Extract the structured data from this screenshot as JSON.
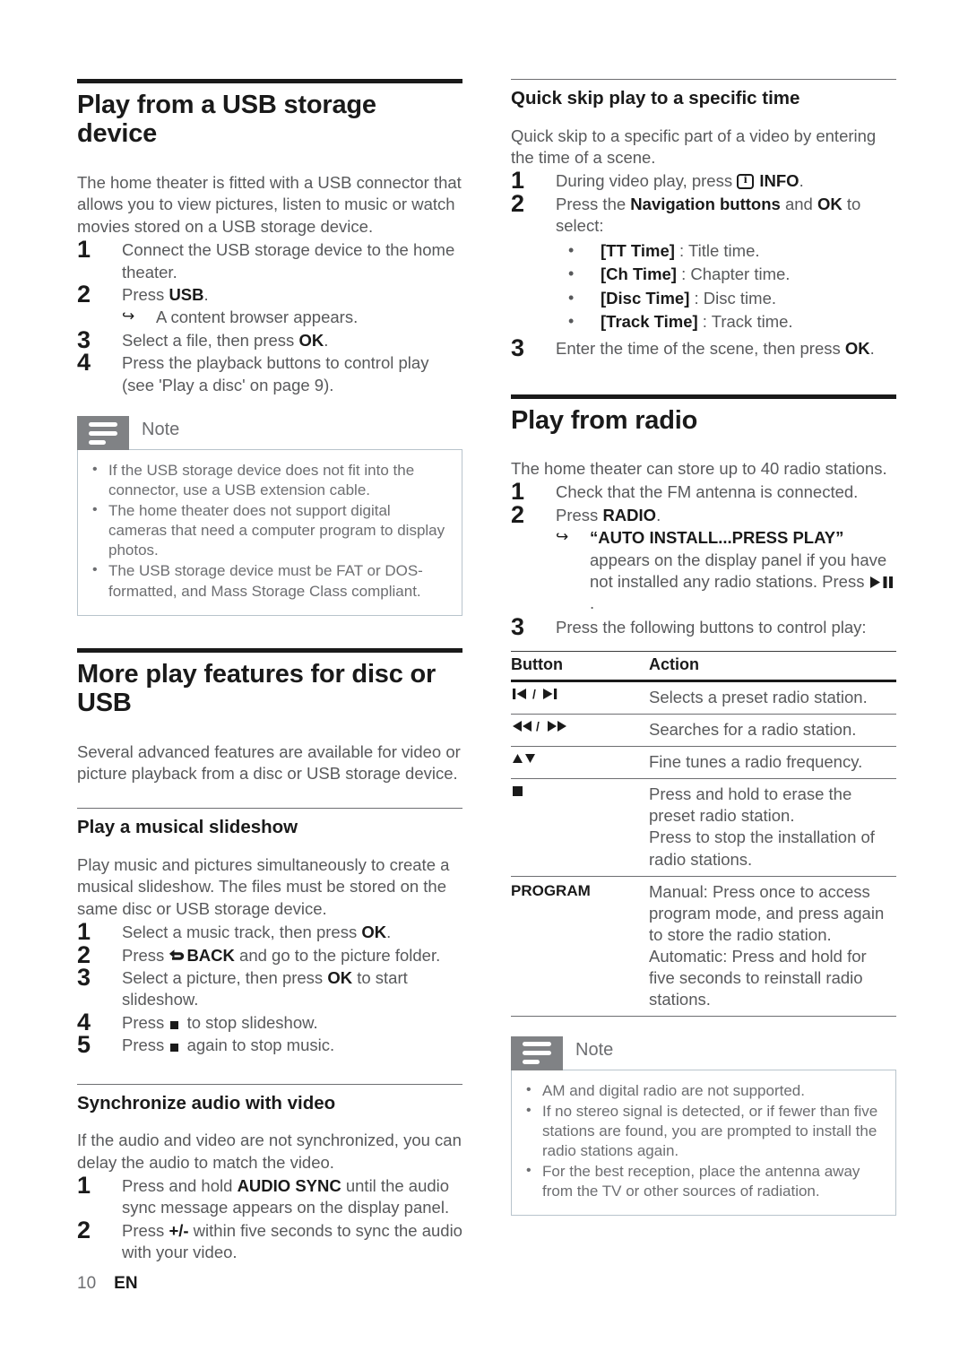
{
  "page": {
    "number": "10",
    "language": "EN"
  },
  "left_column": {
    "section_usb": {
      "heading": "Play from a USB storage device",
      "intro": "The home theater is fitted with a USB connector that allows you to view pictures, listen to music or watch movies stored on a USB storage device.",
      "steps": [
        {
          "num": "1",
          "text": "Connect the USB storage device to the home theater."
        },
        {
          "num": "2",
          "pre": "Press ",
          "bold": "USB",
          "post": ".",
          "result": "A content browser appears."
        },
        {
          "num": "3",
          "pre": "Select a file, then press ",
          "bold": "OK",
          "post": "."
        },
        {
          "num": "4",
          "text": "Press the playback buttons to control play (see 'Play a disc' on page 9)."
        }
      ],
      "note": {
        "title": "Note",
        "items": [
          "If the USB storage device does not fit into the connector, use a USB extension cable.",
          "The home theater does not support digital cameras that need a computer program to display photos.",
          "The USB storage device must be FAT or DOS-formatted, and Mass Storage Class compliant."
        ]
      }
    },
    "section_more": {
      "heading": "More play features for disc or USB",
      "intro": "Several advanced features are available for video or picture playback from a disc or USB storage device.",
      "slideshow": {
        "heading": "Play a musical slideshow",
        "intro": "Play music and pictures simultaneously to create a musical slideshow. The files must be stored on the same disc or USB storage device.",
        "steps": [
          {
            "num": "1",
            "pre": "Select a music track, then press ",
            "bold": "OK",
            "post": "."
          },
          {
            "num": "2",
            "pre": "Press ",
            "icon": "back-arrow-icon",
            "bold": "BACK",
            "post": " and go to the picture folder."
          },
          {
            "num": "3",
            "pre": "Select a picture, then press ",
            "bold": "OK",
            "post": " to start slideshow."
          },
          {
            "num": "4",
            "pre": "Press ",
            "icon": "stop-icon",
            "post": " to stop slideshow."
          },
          {
            "num": "5",
            "pre": "Press ",
            "icon": "stop-icon",
            "post": " again to stop music."
          }
        ]
      },
      "sync": {
        "heading": "Synchronize audio with video",
        "intro": "If the audio and video are not synchronized, you can delay the audio to match the video.",
        "steps": [
          {
            "num": "1",
            "pre": "Press and hold ",
            "bold": "AUDIO SYNC",
            "post": " until the audio sync message appears on the display panel."
          },
          {
            "num": "2",
            "pre": "Press ",
            "bold": "+/-",
            "post": " within five seconds to sync the audio with your video."
          }
        ]
      }
    }
  },
  "right_column": {
    "section_quickskip": {
      "heading": "Quick skip play to a specific time",
      "intro": "Quick skip to a specific part of a video by entering the time of a scene.",
      "step1": {
        "num": "1",
        "pre": "During video play, press ",
        "icon": "info-icon",
        "bold": "INFO",
        "post": "."
      },
      "step2": {
        "num": "2",
        "pre": "Press the ",
        "bold1": "Navigation buttons",
        "mid": " and ",
        "bold2": "OK",
        "post": " to select:"
      },
      "options": [
        {
          "key": "[TT Time]",
          "value": " : Title time."
        },
        {
          "key": "[Ch Time]",
          "value": " : Chapter time."
        },
        {
          "key": "[Disc Time]",
          "value": " : Disc time."
        },
        {
          "key": "[Track Time]",
          "value": " : Track time."
        }
      ],
      "step3": {
        "num": "3",
        "pre": "Enter the time of the scene, then press ",
        "bold": "OK",
        "post": "."
      }
    },
    "section_radio": {
      "heading": "Play from radio",
      "intro": "The home theater can store up to 40 radio stations.",
      "steps": [
        {
          "num": "1",
          "text": "Check that the FM antenna is connected."
        },
        {
          "num": "2",
          "pre": "Press ",
          "bold": "RADIO",
          "post": ".",
          "result_pre": "“AUTO INSTALL...PRESS PLAY”",
          "result_post": " appears on the display panel if you have not installed any radio stations. Press ",
          "result_icon": "play-pause-icon",
          "result_end": "."
        },
        {
          "num": "3",
          "text": "Press the following buttons to control play:"
        }
      ],
      "table": {
        "headers": [
          "Button",
          "Action"
        ],
        "rows": [
          {
            "button_icon": "prev-next-icon",
            "button_label": "⏮ / ⏭",
            "action": "Selects a preset radio station."
          },
          {
            "button_icon": "rewind-forward-icon",
            "button_label": "⏪ / ⏩",
            "action": "Searches for a radio station."
          },
          {
            "button_icon": "up-down-icon",
            "button_label": "▲▼",
            "action": "Fine tunes a radio frequency."
          },
          {
            "button_icon": "stop-icon",
            "button_label": "■",
            "action": "Press and hold to erase the preset radio station.\nPress to stop the installation of radio stations."
          },
          {
            "button_icon": "",
            "button_label": "PROGRAM",
            "action": "Manual: Press once to access program mode, and press again to store the radio station.\nAutomatic: Press and hold for five seconds to reinstall radio stations."
          }
        ]
      },
      "note": {
        "title": "Note",
        "items": [
          "AM and digital radio are not supported.",
          "If no stereo signal is detected, or if fewer than five stations are found, you are prompted to install the radio stations again.",
          "For the best reception, place the antenna away from the TV or other sources of radiation."
        ]
      }
    }
  },
  "colors": {
    "body_text": "#58595b",
    "heading_text": "#1a1a1a",
    "note_tab": "#808285",
    "note_border": "#b8c4cc"
  }
}
